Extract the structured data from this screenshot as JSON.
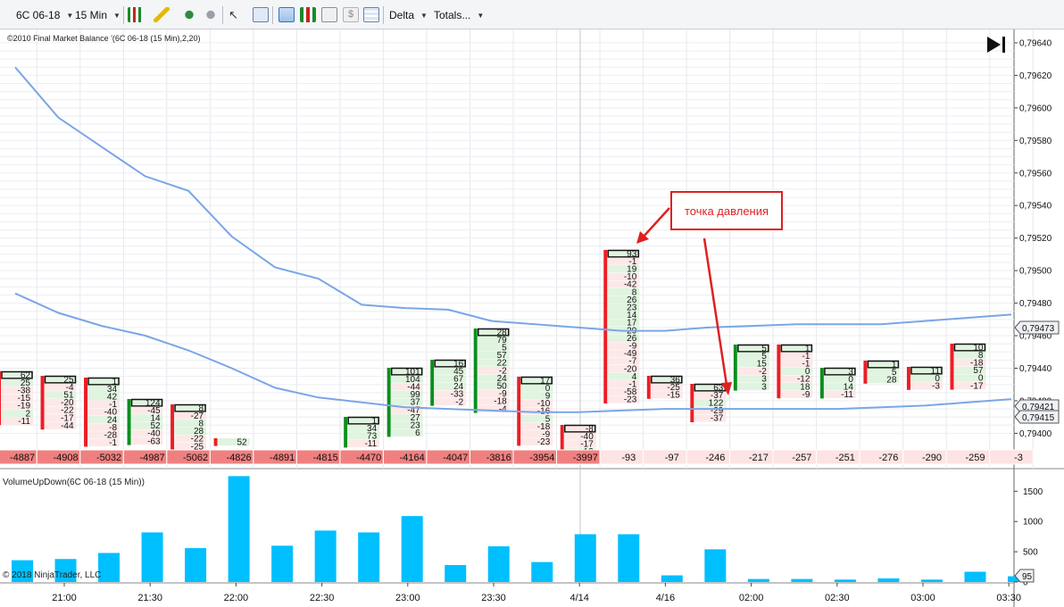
{
  "toolbar": {
    "instrument": "6C 06-18",
    "interval": "15 Min",
    "drawing_tools": [
      "bar-style-icon",
      "pencil-icon",
      "add-indicator-icon",
      "remove-indicator-icon",
      "cursor-icon",
      "zoom-icon",
      "chart-trader-icon",
      "candles-icon",
      "strategy-icon",
      "dollar-icon",
      "properties-icon"
    ],
    "delta_label": "Delta",
    "totals_label": "Totals..."
  },
  "chart": {
    "indicator_label": "©2010 Final Market Balance  '(6C 06-18 (15 Min),2,20)",
    "annotation_text": "точка давления",
    "copyright": "© 2018 NinjaTrader, LLC",
    "lower_panel_label": "VolumeUpDown(6C 06-18 (15 Min))",
    "price_tag_1": "0,79473",
    "price_tag_2": "0,79421",
    "price_tag_3": "0,79415",
    "volume_tag": "95",
    "colors": {
      "line": "#7aa6e6",
      "volume": "#00bfff",
      "up": "#0a8f1c",
      "down": "#ee1c24",
      "annotation": "#e02020"
    }
  },
  "chart_data": [
    {
      "type": "table",
      "title": "",
      "y_axis_labels": [
        "0,79640",
        "0,79620",
        "0,79600",
        "0,79580",
        "0,79560",
        "0,79540",
        "0,79520",
        "0,79500",
        "0,79480",
        "0,79460",
        "0,79440",
        "0,79420",
        "0,79400"
      ],
      "ylim": [
        0.79392,
        0.79646
      ],
      "delta_totals": [
        "-4887",
        "-4908",
        "-5032",
        "-4987",
        "-5062",
        "-4826",
        "-4891",
        "-4815",
        "-4470",
        "-4164",
        "-4047",
        "-3816",
        "-3954",
        "-3997",
        "-93",
        "-97",
        "-246",
        "-217",
        "-257",
        "-251",
        "-276",
        "-290",
        "-259",
        "-3"
      ],
      "footprint_columns": [
        {
          "cells": [
            "62",
            "25",
            "-38",
            "-15",
            "-19",
            "2",
            "-11"
          ]
        },
        {
          "cells": [
            "25",
            "-4",
            "51",
            "-20",
            "-22",
            "-17",
            "-44"
          ]
        },
        {
          "cells": [
            "1",
            "34",
            "42",
            "-1",
            "-40",
            "24",
            "-8",
            "-28",
            "-1"
          ]
        },
        {
          "cells": [
            "124",
            "-45",
            "14",
            "52",
            "-40",
            "-63"
          ]
        },
        {
          "cells": [
            "8",
            "-27",
            "8",
            "28",
            "-22",
            "-25"
          ]
        },
        {
          "cells": [
            "52"
          ]
        },
        {
          "cells": []
        },
        {
          "cells": []
        },
        {
          "cells": [
            "1",
            "34",
            "73",
            "-11"
          ]
        },
        {
          "cells": [
            "101",
            "104",
            "-44",
            "99",
            "37",
            "-47",
            "27",
            "23",
            "6"
          ]
        },
        {
          "cells": [
            "16",
            "45",
            "67",
            "24",
            "-33",
            "-2"
          ]
        },
        {
          "cells": [
            "28",
            "79",
            "5",
            "57",
            "22",
            "-2",
            "24",
            "50",
            "-9",
            "-18",
            "-4"
          ]
        },
        {
          "cells": [
            "17",
            "0",
            "9",
            "-10",
            "-16",
            "5",
            "-18",
            "-9",
            "-23"
          ]
        },
        {
          "cells": [
            "-8",
            "-40",
            "-17",
            "13"
          ]
        },
        {
          "cells": [
            "93",
            "-1",
            "19",
            "-10",
            "-42",
            "8",
            "26",
            "23",
            "14",
            "17",
            "29",
            "26",
            "-9",
            "-49",
            "-7",
            "-20",
            "4",
            "-1",
            "-58",
            "-23"
          ]
        },
        {
          "cells": [
            "36",
            "-25",
            "-15"
          ]
        },
        {
          "cells": [
            "63",
            "-37",
            "122",
            "-29",
            "-37"
          ]
        },
        {
          "cells": [
            "5",
            "5",
            "15",
            "-2",
            "3",
            "3"
          ]
        },
        {
          "cells": [
            "1",
            "-1",
            "-1",
            "0",
            "-12",
            "18",
            "-9"
          ]
        },
        {
          "cells": [
            "3",
            "0",
            "14",
            "-11"
          ]
        },
        {
          "cells": [
            "1",
            "5",
            "28"
          ]
        },
        {
          "cells": [
            "11",
            "0",
            "-3"
          ]
        },
        {
          "cells": [
            "10",
            "8",
            "-18",
            "57",
            "0",
            "-17"
          ]
        },
        {
          "cells": []
        }
      ],
      "lines": [
        {
          "values": [
            0.79625,
            0.79594,
            0.79576,
            0.79558,
            0.79549,
            0.79521,
            0.79502,
            0.79495,
            0.79479,
            0.79477,
            0.79476,
            0.79469,
            0.79467,
            0.79465,
            0.79463,
            0.79463,
            0.79465,
            0.79466,
            0.79467,
            0.79467,
            0.79467,
            0.79469,
            0.79471,
            0.79473
          ]
        },
        {
          "values": [
            0.79486,
            0.79474,
            0.79466,
            0.7946,
            0.79451,
            0.7944,
            0.79428,
            0.79422,
            0.79419,
            0.79416,
            0.79415,
            0.79414,
            0.79413,
            0.79413,
            0.79414,
            0.79415,
            0.79415,
            0.79415,
            0.79415,
            0.79415,
            0.79416,
            0.79417,
            0.79419,
            0.79421
          ]
        }
      ]
    },
    {
      "type": "bar",
      "title": "VolumeUpDown(6C 06-18 (15 Min))",
      "y_axis_labels": [
        "1500",
        "1000",
        "500",
        "0"
      ],
      "ylim": [
        0,
        1800
      ],
      "x_axis_labels": [
        "21:00",
        "21:30",
        "22:00",
        "22:30",
        "23:00",
        "23:30",
        "4/14",
        "4/16",
        "02:00",
        "02:30",
        "03:00",
        "03:30"
      ],
      "values": [
        360,
        380,
        480,
        820,
        560,
        1750,
        600,
        850,
        820,
        1090,
        280,
        590,
        330,
        790,
        790,
        110,
        540,
        50,
        50,
        40,
        60,
        40,
        170,
        95
      ]
    }
  ]
}
